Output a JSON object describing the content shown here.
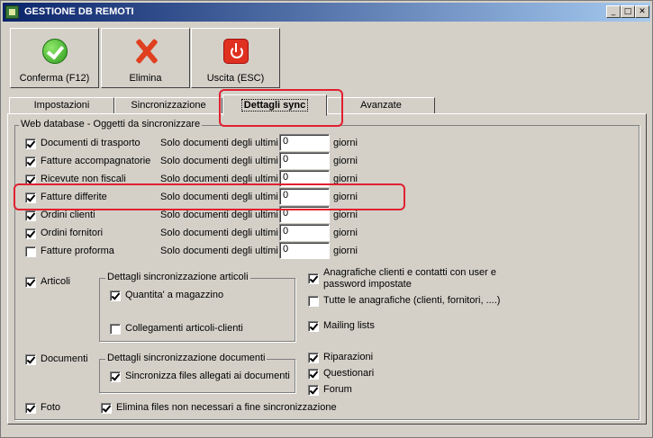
{
  "window": {
    "title": "GESTIONE DB REMOTI",
    "min": "_",
    "max": "□",
    "close": "✕"
  },
  "toolbar": {
    "confirm": "Conferma (F12)",
    "delete": "Elimina",
    "exit": "Uscita (ESC)"
  },
  "tabs": [
    "Impostazioni",
    "Sincronizzazione",
    "Dettagli sync",
    "Avanzate"
  ],
  "web_group": {
    "title": "Web database - Oggetti da sincronizzare"
  },
  "docs": [
    {
      "label": "Documenti di trasporto",
      "checked": true,
      "prefix": "Solo documenti degli ultimi",
      "days": "0",
      "suffix": "giorni"
    },
    {
      "label": "Fatture accompagnatorie",
      "checked": true,
      "prefix": "Solo documenti degli ultimi",
      "days": "0",
      "suffix": "giorni"
    },
    {
      "label": "Ricevute non fiscali",
      "checked": true,
      "prefix": "Solo documenti degli ultimi",
      "days": "0",
      "suffix": "giorni"
    },
    {
      "label": "Fatture differite",
      "checked": true,
      "prefix": "Solo documenti degli ultimi",
      "days": "0",
      "suffix": "giorni"
    },
    {
      "label": "Ordini clienti",
      "checked": true,
      "prefix": "Solo documenti degli ultimi",
      "days": "0",
      "suffix": "giorni"
    },
    {
      "label": "Ordini fornitori",
      "checked": true,
      "prefix": "Solo documenti degli ultimi",
      "days": "0",
      "suffix": "giorni"
    },
    {
      "label": "Fatture proforma",
      "checked": false,
      "prefix": "Solo documenti degli ultimi",
      "days": "0",
      "suffix": "giorni"
    }
  ],
  "articoli": {
    "label": "Articoli",
    "group_title": "Dettagli sincronizzazione articoli",
    "qty": "Quantita' a magazzino",
    "links": "Collegamenti articoli-clienti"
  },
  "right": {
    "anag_line1": "Anagrafiche clienti e contatti con user e",
    "anag_line2": "password impostate",
    "all_anag": "Tutte le anagrafiche (clienti, fornitori, ....)",
    "mailing": "Mailing lists",
    "riparazioni": "Riparazioni",
    "questionari": "Questionari",
    "forum": "Forum"
  },
  "documenti": {
    "label": "Documenti",
    "group_title": "Dettagli sincronizzazione documenti",
    "sync_files": "Sincronizza files allegati ai documenti"
  },
  "foto": {
    "label": "Foto",
    "delete_files": "Elimina files non necessari a fine sincronizzazione"
  }
}
